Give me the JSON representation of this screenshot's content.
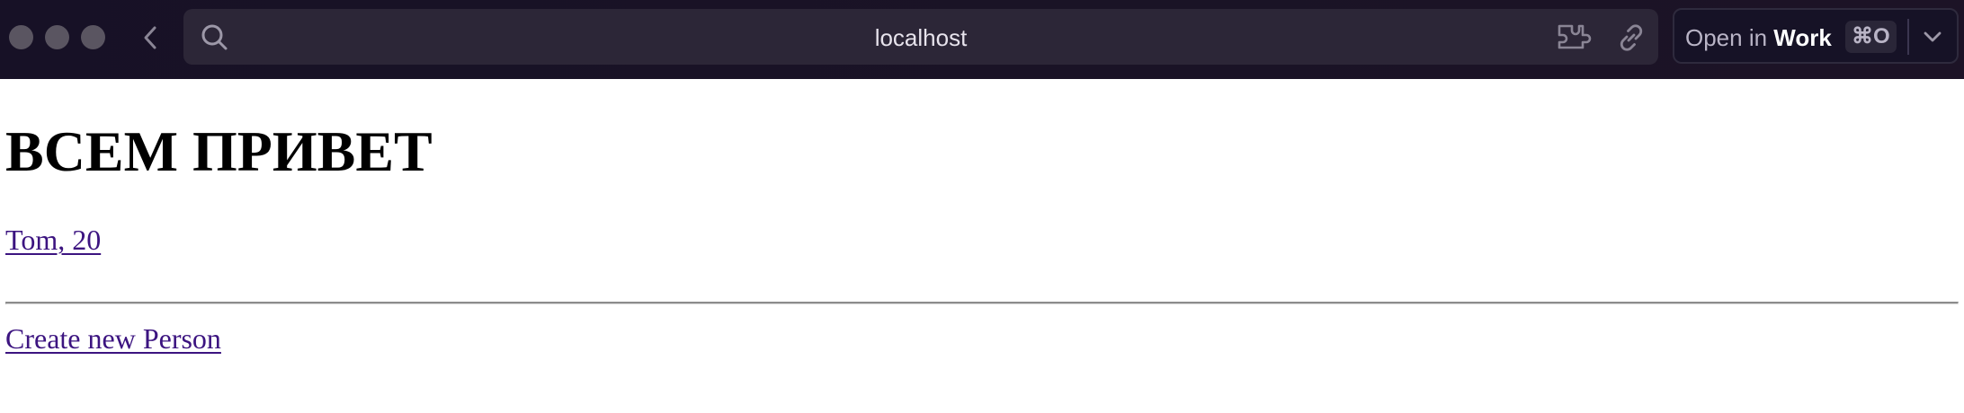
{
  "browser": {
    "address_bar": {
      "url": "localhost"
    },
    "open_in": {
      "prefix": "Open in ",
      "target": "Work",
      "shortcut": "⌘O"
    },
    "icons": {
      "back": "chevron-left-icon",
      "search": "search-icon",
      "extension": "extension-icon",
      "link": "link-icon",
      "dropdown": "chevron-down-icon"
    },
    "colors": {
      "toolbar_bg": "#171126",
      "address_bar_bg": "#2c2637",
      "link": "#3c1480"
    }
  },
  "page": {
    "title": "ВСЕМ ПРИВЕТ",
    "people": [
      {
        "label": "Tom, 20"
      }
    ],
    "create_link": "Create new Person"
  }
}
